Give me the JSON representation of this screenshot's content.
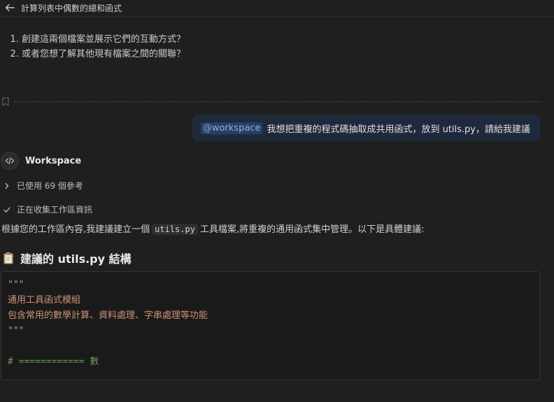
{
  "header": {
    "title": "計算列表中偶數的總和函式"
  },
  "questions": [
    "創建這兩個檔案並展示它們的互動方式？",
    "或者您想了解其他現有檔案之間的關聯？"
  ],
  "user_message": {
    "mention": "@workspace",
    "text": "我想把重複的程式碼抽取成共用函式，放到 utils.py，請給我建議"
  },
  "assistant": {
    "name": "Workspace",
    "references_label": "已使用 69 個參考",
    "status_label": "正在收集工作區資訊",
    "intro_before": "根據您的工作區內容,我建議建立一個",
    "intro_code": "utils.py",
    "intro_after": "工具檔案,將重複的通用函式集中管理。以下是具體建議:",
    "section_title": "建議的 utils.py 結構",
    "code_lines": [
      "\"\"\"",
      "通用工具函式模組",
      "包含常用的數學計算、資料處理、字串處理等功能",
      "\"\"\"",
      "",
      "# ============ 數"
    ]
  },
  "colors": {
    "background": "#1f1f1f",
    "mention": "#7fb2f0",
    "string": "#ce9178",
    "comment": "#6a9955"
  },
  "icons": [
    "arrow-left-icon",
    "bookmark-icon",
    "code-icon",
    "chevron-right-icon",
    "check-icon",
    "clipboard-icon"
  ]
}
